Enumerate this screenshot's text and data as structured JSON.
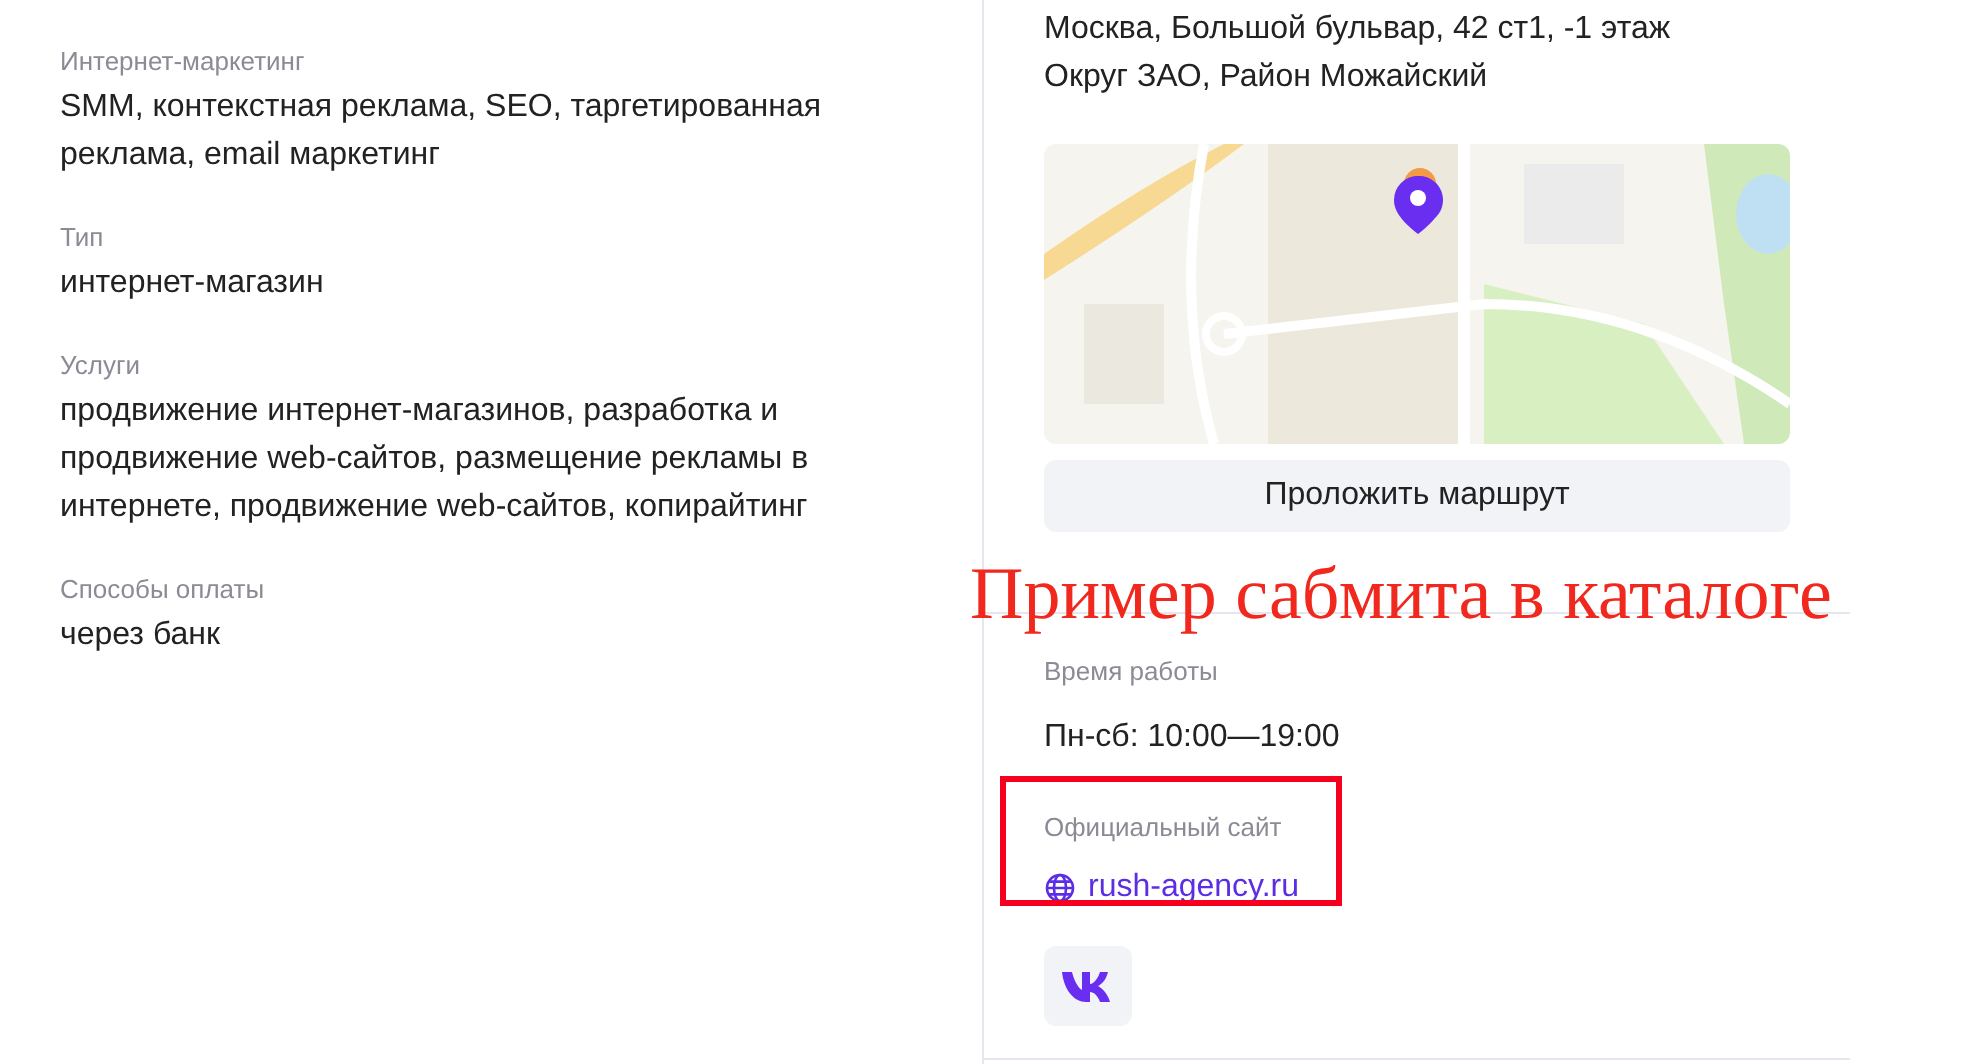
{
  "details": [
    {
      "label": "Интернет-маркетинг",
      "value": "SMM, контекстная реклама, SEO, таргетированная реклама, email маркетинг"
    },
    {
      "label": "Тип",
      "value": "интернет-магазин"
    },
    {
      "label": "Услуги",
      "value": "продвижение интернет-магазинов, разработка и продвижение web-сайтов, размещение рекламы в интернете, продвижение web-сайтов, копирайтинг"
    },
    {
      "label": "Способы оплаты",
      "value": "через банк"
    }
  ],
  "address": [
    "Москва, Большой бульвар, 42 ст1, -1 этаж",
    "Округ ЗАО, Район Можайский"
  ],
  "route_button": "Проложить маршрут",
  "hours": {
    "label": "Время работы",
    "value": "Пн-сб: 10:00—19:00"
  },
  "website": {
    "label": "Официальный сайт",
    "url": "rush-agency.ru"
  },
  "annotation": {
    "text": "Пример сабмита в каталоге"
  }
}
